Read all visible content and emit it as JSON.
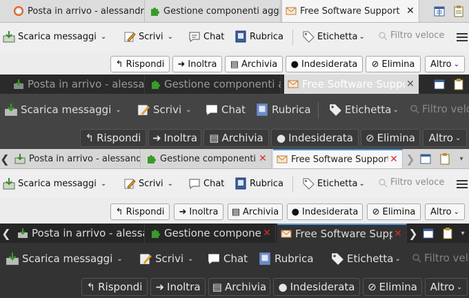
{
  "tabs": {
    "inbox": "Posta in arrivo - alessandro",
    "addons": "Gestione componenti aggiuntivi",
    "fss": "Free Software Support"
  },
  "toolbar": {
    "get_messages": "Scarica messaggi",
    "write": "Scrivi",
    "chat": "Chat",
    "address_book": "Rubrica",
    "tag": "Etichetta",
    "quick_filter": "Filtro veloce"
  },
  "header_buttons": {
    "reply": "Rispondi",
    "forward": "Inoltra",
    "archive": "Archivia",
    "junk": "Indesiderata",
    "delete": "Elimina",
    "more": "Altro"
  },
  "colors": {
    "light_bg": "#ececec",
    "dark_bg": "#333333",
    "accent_blue": "#4a90d9",
    "close_red": "#d03030",
    "addon_green": "#3a9a2a"
  }
}
